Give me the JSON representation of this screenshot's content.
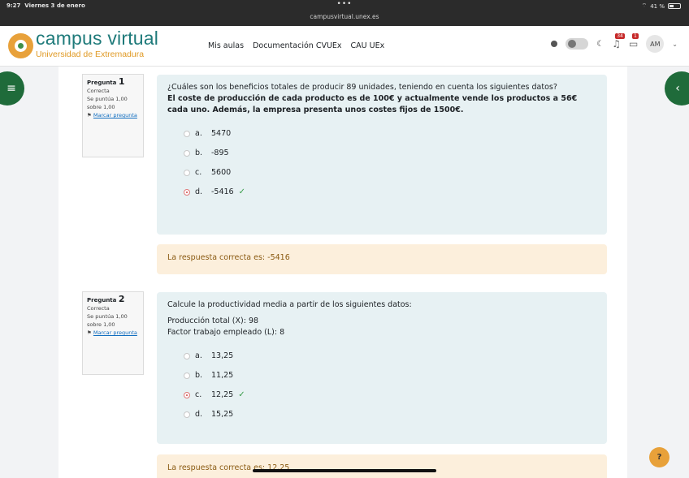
{
  "status_bar": {
    "time": "9:27",
    "date": "Viernes 3 de enero",
    "dots": "•••",
    "url": "campusvirtual.unex.es",
    "battery": "41 %"
  },
  "brand": {
    "title": "campus virtual",
    "subtitle": "Universidad de Extremadura"
  },
  "nav": {
    "links": [
      "Mis aulas",
      "Documentación CVUEx",
      "CAU UEx"
    ],
    "notifications_count": "34",
    "messages_count": "1",
    "avatar": "AM"
  },
  "questions": [
    {
      "label": "Pregunta",
      "number": "1",
      "status": "Correcta",
      "score_line1": "Se puntúa 1,00",
      "score_line2": "sobre 1,00",
      "flag_label": "Marcar pregunta",
      "text_plain": "¿Cuáles son los beneficios totales de producir 89 unidades, teniendo en cuenta los siguientes datos?",
      "text_bold": "El coste de producción de cada producto es de 100€ y actualmente vende los productos a 56€ cada uno. Además, la empresa presenta unos costes fijos de 1500€.",
      "answers": [
        {
          "letter": "a.",
          "value": "5470",
          "selected": false
        },
        {
          "letter": "b.",
          "value": "-895",
          "selected": false
        },
        {
          "letter": "c.",
          "value": "5600",
          "selected": false
        },
        {
          "letter": "d.",
          "value": "-5416",
          "selected": true
        }
      ],
      "feedback": "La respuesta correcta es: -5416"
    },
    {
      "label": "Pregunta",
      "number": "2",
      "status": "Correcta",
      "score_line1": "Se puntúa 1,00",
      "score_line2": "sobre 1,00",
      "flag_label": "Marcar pregunta",
      "text_plain": "Calcule la productividad media a partir de los siguientes datos:",
      "line1": "Producción total (X): 98",
      "line2": "Factor trabajo empleado (L): 8",
      "answers": [
        {
          "letter": "a.",
          "value": "13,25",
          "selected": false
        },
        {
          "letter": "b.",
          "value": "11,25",
          "selected": false
        },
        {
          "letter": "c.",
          "value": "12,25",
          "selected": true
        },
        {
          "letter": "d.",
          "value": "15,25",
          "selected": false
        }
      ],
      "feedback": "La respuesta correcta es: 12,25"
    }
  ],
  "help_label": "?",
  "colors": {
    "brand_teal": "#1e7a7a",
    "brand_orange": "#e09a25",
    "question_bg": "#e7f1f3",
    "feedback_bg": "#fcefdc",
    "drawer_green": "#1f6b3a"
  }
}
